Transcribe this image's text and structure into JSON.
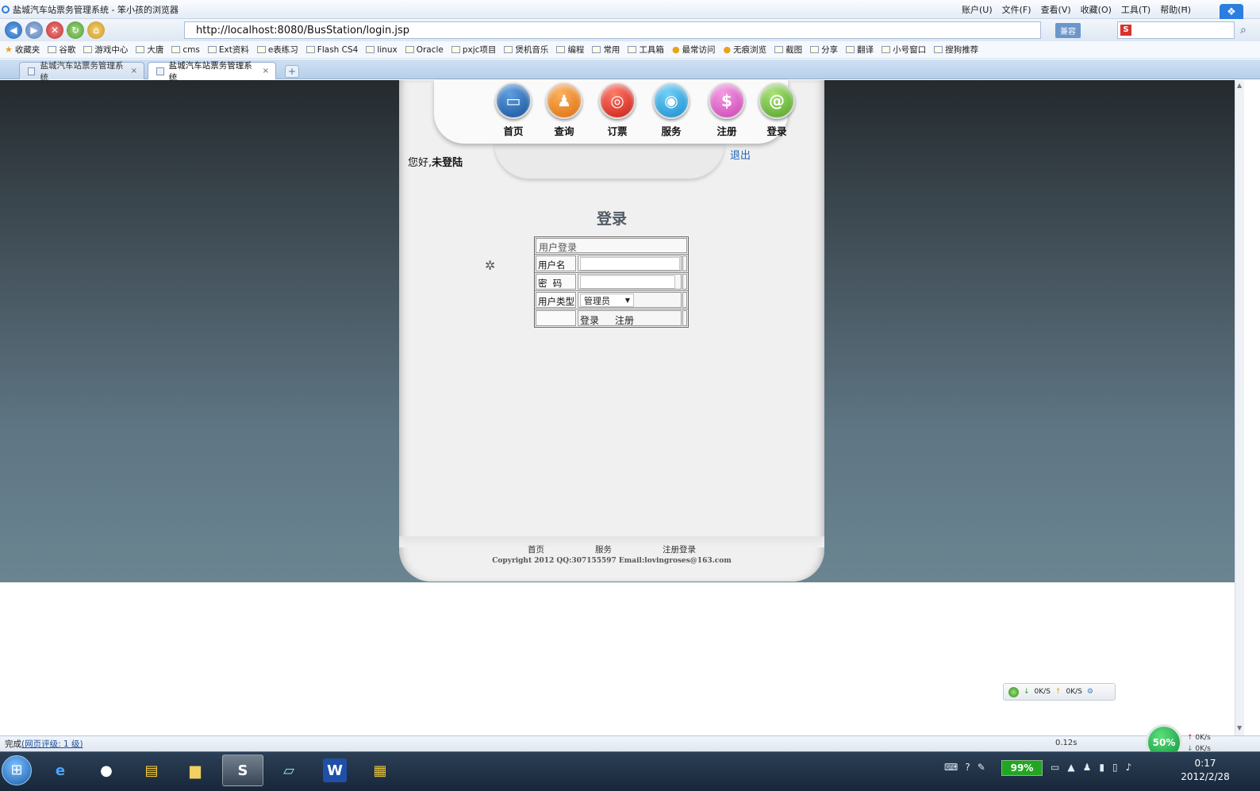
{
  "window": {
    "title": "盐城汽车站票务管理系统 - 笨小孩的浏览器",
    "menus": [
      "账户(U)",
      "文件(F)",
      "查看(V)",
      "收藏(O)",
      "工具(T)",
      "帮助(H)"
    ],
    "minimize": "–",
    "close": "×",
    "cloud_icon": "cloud-icon"
  },
  "address": {
    "url": "http://localhost:8080/BusStation/login.jsp",
    "compat_label": "兼容",
    "search_engine_letter": "S"
  },
  "favorites": [
    "收藏夹",
    "谷歌",
    "游戏中心",
    "大唐",
    "cms",
    "Ext资料",
    "e表练习",
    "Flash CS4",
    "linux",
    "Oracle",
    "pxjc项目",
    "煲机音乐",
    "编程",
    "常用",
    "工具箱",
    "最常访问",
    "无痕浏览",
    "截图",
    "分享",
    "翻译",
    "小号窗口",
    "搜狗推荐"
  ],
  "tabs": [
    {
      "label": "盐城汽车站票务管理系统",
      "close": "×"
    },
    {
      "label": "盐城汽车站票务管理系统",
      "close": "×"
    }
  ],
  "new_tab": "+",
  "site": {
    "nav": [
      {
        "label": "首页",
        "icon": "monitor-icon",
        "glyph": "▭"
      },
      {
        "label": "查询",
        "icon": "user-icon",
        "glyph": "♟"
      },
      {
        "label": "订票",
        "icon": "ticket-icon",
        "glyph": "◎"
      },
      {
        "label": "服务",
        "icon": "service-icon",
        "glyph": "◉"
      },
      {
        "label": "注册",
        "icon": "dollar-icon",
        "glyph": "$"
      },
      {
        "label": "登录",
        "icon": "at-icon",
        "glyph": "@"
      }
    ],
    "greeting_prefix": "您好,",
    "greeting_status": "未登陆",
    "logout": "退出",
    "login_heading": "登录",
    "form": {
      "caption": "用户登录",
      "username_label": "用户名",
      "password_label": "密  码",
      "user_type_label": "用户类型",
      "user_type_value": "管理员",
      "login_button": "登录",
      "register_button": "注册"
    },
    "footer_links": [
      "首页",
      "服务",
      "注册登录"
    ],
    "copyright": "Copyright 2012 QQ:307155597 Email:lovingroses@163.com"
  },
  "speed_widget": {
    "down": "0K/S",
    "up": "0K/S"
  },
  "status": {
    "text": "完成",
    "rating": "(网页评级: 1 级)",
    "timing": "0.12s",
    "cpu_percent": "50%",
    "up_speed": "0K/s",
    "down_speed": "0K/s"
  },
  "taskbar": {
    "battery": "99%",
    "battery_level": 0.99,
    "time": "0:17",
    "date": "2012/2/28"
  }
}
